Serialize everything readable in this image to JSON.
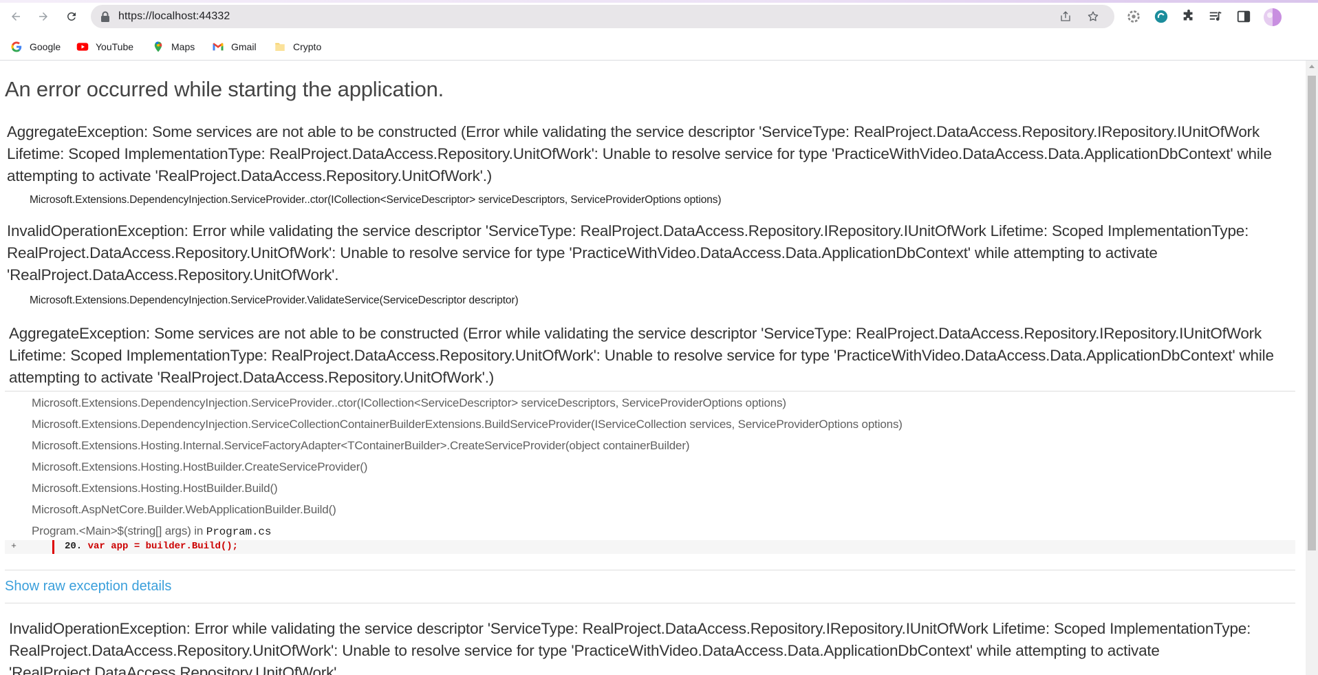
{
  "browser": {
    "url": "https://localhost:44332",
    "bookmarks": [
      {
        "label": "Google",
        "icon": "google-icon"
      },
      {
        "label": "YouTube",
        "icon": "youtube-icon"
      },
      {
        "label": "Maps",
        "icon": "maps-icon"
      },
      {
        "label": "Gmail",
        "icon": "gmail-icon"
      },
      {
        "label": "Crypto",
        "icon": "folder-icon"
      }
    ]
  },
  "page": {
    "title": "An error occurred while starting the application.",
    "errors": [
      {
        "message": "AggregateException: Some services are not able to be constructed (Error while validating the service descriptor 'ServiceType: RealProject.DataAccess.Repository.IRepository.IUnitOfWork Lifetime: Scoped ImplementationType: RealProject.DataAccess.Repository.UnitOfWork': Unable to resolve service for type 'PracticeWithVideo.DataAccess.Data.ApplicationDbContext' while attempting to activate 'RealProject.DataAccess.Repository.UnitOfWork'.)",
        "frame": "Microsoft.Extensions.DependencyInjection.ServiceProvider..ctor(ICollection<ServiceDescriptor> serviceDescriptors, ServiceProviderOptions options)"
      },
      {
        "message": "InvalidOperationException: Error while validating the service descriptor 'ServiceType: RealProject.DataAccess.Repository.IRepository.IUnitOfWork Lifetime: Scoped ImplementationType: RealProject.DataAccess.Repository.UnitOfWork': Unable to resolve service for type 'PracticeWithVideo.DataAccess.Data.ApplicationDbContext' while attempting to activate 'RealProject.DataAccess.Repository.UnitOfWork'.",
        "frame": "Microsoft.Extensions.DependencyInjection.ServiceProvider.ValidateService(ServiceDescriptor descriptor)"
      },
      {
        "message": "AggregateException: Some services are not able to be constructed (Error while validating the service descriptor 'ServiceType: RealProject.DataAccess.Repository.IRepository.IUnitOfWork Lifetime: Scoped ImplementationType: RealProject.DataAccess.Repository.UnitOfWork': Unable to resolve service for type 'PracticeWithVideo.DataAccess.Data.ApplicationDbContext' while attempting to activate 'RealProject.DataAccess.Repository.UnitOfWork'.)"
      },
      {
        "message": "InvalidOperationException: Error while validating the service descriptor 'ServiceType: RealProject.DataAccess.Repository.IRepository.IUnitOfWork Lifetime: Scoped ImplementationType: RealProject.DataAccess.Repository.UnitOfWork': Unable to resolve service for type 'PracticeWithVideo.DataAccess.Data.ApplicationDbContext' while attempting to activate 'RealProject.DataAccess.Repository.UnitOfWork'."
      }
    ],
    "stack_frames": [
      "Microsoft.Extensions.DependencyInjection.ServiceProvider..ctor(ICollection<ServiceDescriptor> serviceDescriptors, ServiceProviderOptions options)",
      "Microsoft.Extensions.DependencyInjection.ServiceCollectionContainerBuilderExtensions.BuildServiceProvider(IServiceCollection services, ServiceProviderOptions options)",
      "Microsoft.Extensions.Hosting.Internal.ServiceFactoryAdapter<TContainerBuilder>.CreateServiceProvider(object containerBuilder)",
      "Microsoft.Extensions.Hosting.HostBuilder.CreateServiceProvider()",
      "Microsoft.Extensions.Hosting.HostBuilder.Build()",
      "Microsoft.AspNetCore.Builder.WebApplicationBuilder.Build()"
    ],
    "program_frame": {
      "method": "Program.<Main>$(string[] args) in ",
      "file": "Program.cs"
    },
    "code": {
      "expand": "+",
      "line_number": "20.",
      "line_text": " var app = builder.Build();"
    },
    "raw_link": "Show raw exception details"
  },
  "colors": {
    "link": "#3a9fdb",
    "code_error": "#cc0000",
    "frame_text": "#606060"
  }
}
